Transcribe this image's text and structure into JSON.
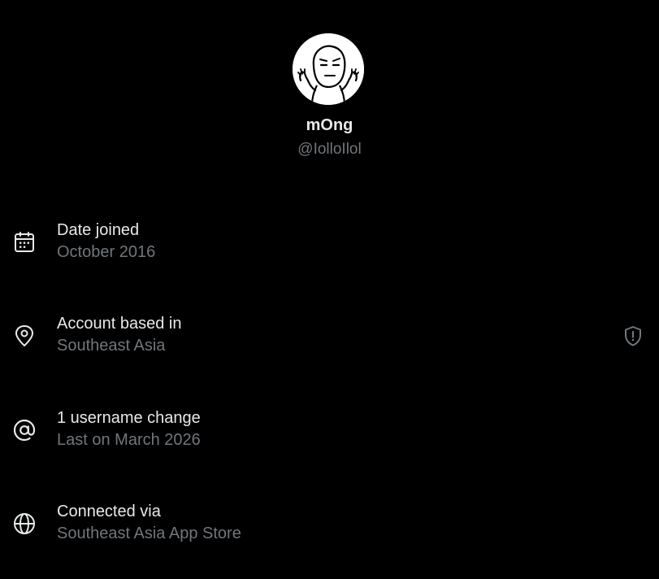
{
  "profile": {
    "display_name": "mOng",
    "handle": "@IolloIlol",
    "avatar_icon": "meme-face-avatar"
  },
  "about": {
    "items": [
      {
        "icon": "calendar-icon",
        "title": "Date joined",
        "subtitle": "October 2016"
      },
      {
        "icon": "location-pin-icon",
        "title": "Account based in",
        "subtitle": "Southeast Asia",
        "trailing_icon": "shield-alert-icon"
      },
      {
        "icon": "at-sign-icon",
        "title": "1 username change",
        "subtitle": "Last on March 2026"
      },
      {
        "icon": "globe-icon",
        "title": "Connected via",
        "subtitle": "Southeast Asia App Store"
      }
    ]
  },
  "colors": {
    "background": "#000000",
    "primary_text": "#e7e9ea",
    "secondary_text": "#71767b"
  }
}
